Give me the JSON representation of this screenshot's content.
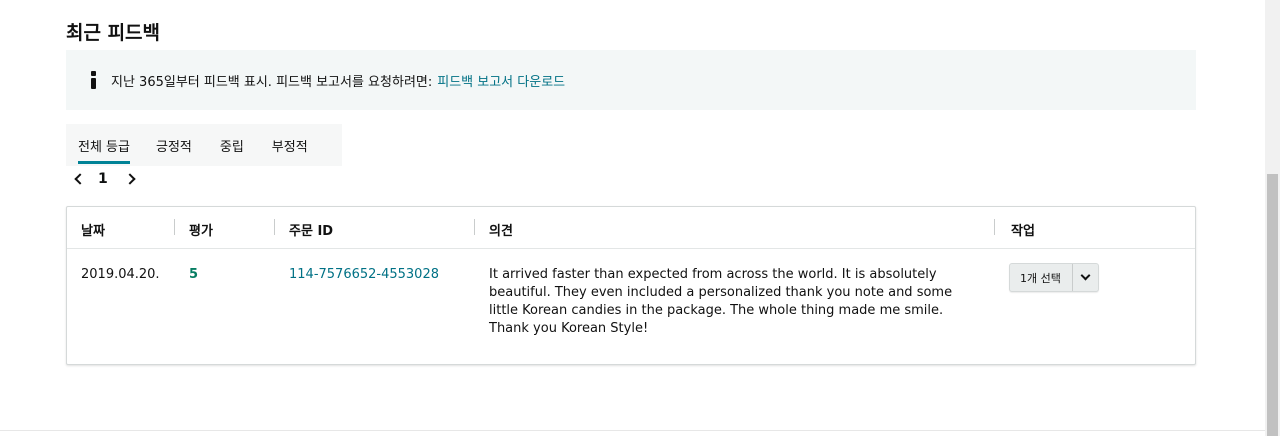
{
  "section": {
    "title": "최근 피드백"
  },
  "info": {
    "icon": "info-icon",
    "text": "지난 365일부터 피드백 표시. 피드백 보고서를 요청하려면:",
    "link": "피드백 보고서 다운로드"
  },
  "tabs": [
    {
      "label": "전체 등급",
      "active": true
    },
    {
      "label": "긍정적",
      "active": false
    },
    {
      "label": "중립",
      "active": false
    },
    {
      "label": "부정적",
      "active": false
    }
  ],
  "pagination": {
    "current": "1"
  },
  "table": {
    "columns": [
      "날짜",
      "평가",
      "주문 ID",
      "의견",
      "작업"
    ],
    "rows": [
      {
        "date": "2019.04.20.",
        "rating": "5",
        "order_id": "114-7576652-4553028",
        "comment": "It arrived faster than expected from across the world. It is absolutely beautiful. They even included a personalized thank you note and some little Korean candies in the package. The whole thing made me smile. Thank you Korean Style!",
        "action": "1개 선택"
      }
    ]
  },
  "colors": {
    "link": "#007185",
    "rating": "#067d62",
    "tab_underline": "#008296",
    "info_bg": "#f3f7f7"
  }
}
